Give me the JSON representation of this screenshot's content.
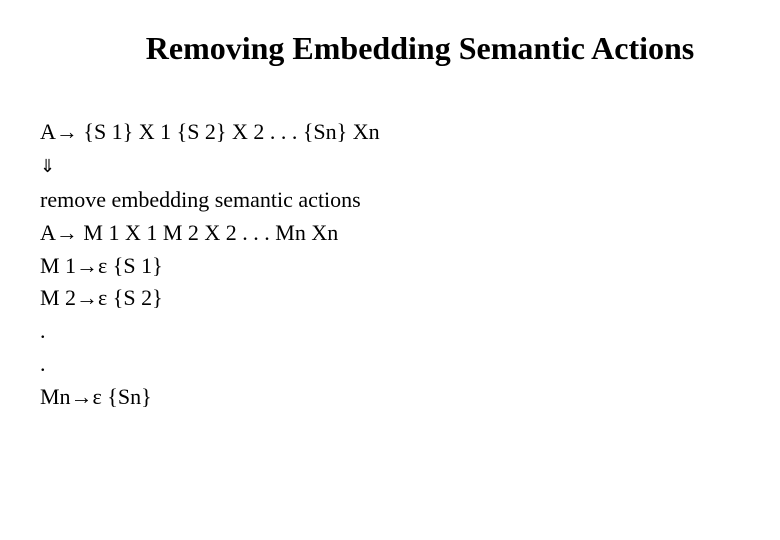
{
  "title": "Removing Embedding Semantic Actions",
  "lines": {
    "l1": "A→ {S 1} X 1 {S 2} X 2 . . . {Sn} Xn",
    "arrow": "⇓",
    "l2": "remove embedding semantic actions",
    "l3": "A→ M 1 X 1 M 2 X 2 . . . Mn Xn",
    "l4": "M 1→ε {S 1}",
    "l5": "M 2→ε {S 2}",
    "l6": ".",
    "l7": ".",
    "l8": "Mn→ε {Sn}"
  }
}
